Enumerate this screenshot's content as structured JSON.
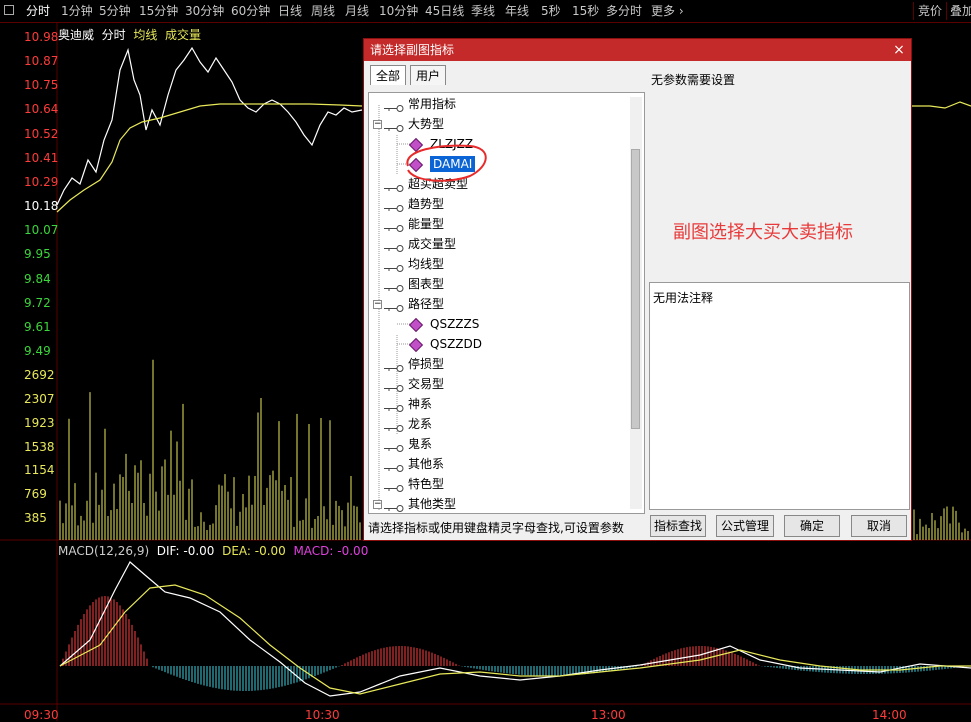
{
  "toolbar": {
    "items": [
      "分时",
      "1分钟",
      "5分钟",
      "15分钟",
      "30分钟",
      "60分钟",
      "日线",
      "周线",
      "月线",
      "10分钟",
      "45日线",
      "季线",
      "年线",
      "5秒",
      "15秒",
      "多分时",
      "更多"
    ],
    "right_items": [
      "竞价",
      "叠加"
    ]
  },
  "chart": {
    "legend": {
      "name": "奥迪威",
      "mode": "分时",
      "avg": "均线",
      "vol": "成交量"
    },
    "price_ticks": [
      "10.98",
      "10.87",
      "10.75",
      "10.64",
      "10.52",
      "10.41",
      "10.29",
      "10.18",
      "10.07",
      "9.95",
      "9.84",
      "9.72",
      "9.61",
      "9.49"
    ],
    "volume_ticks": [
      "2692",
      "2307",
      "1923",
      "1538",
      "1154",
      "769",
      "385"
    ],
    "macd_legend": {
      "title": "MACD(12,26,9)",
      "dif": "DIF: -0.00",
      "dea": "DEA: -0.00",
      "macd": "MACD: -0.00"
    },
    "time_labels": [
      "09:30",
      "10:30",
      "13:00",
      "14:00"
    ],
    "colors": {
      "up": "#ff3b3b",
      "down": "#3bd63b",
      "base": "#ffffff",
      "avg": "#e8e85a",
      "vol": "#e8e85a",
      "macd_pos": "#ff4040",
      "macd_neg": "#40d0e0",
      "dea": "#e8e85a",
      "dif": "#ffffff",
      "macd_text": "#e040e0"
    }
  },
  "dialog": {
    "title": "请选择副图指标",
    "close": "×",
    "tabs": [
      "全部",
      "用户"
    ],
    "tree": [
      {
        "label": "常用指标",
        "type": "group",
        "expanded": false
      },
      {
        "label": "大势型",
        "type": "group",
        "expanded": true
      },
      {
        "label": "ZLZJZZ",
        "type": "leaf"
      },
      {
        "label": "DAMAI",
        "type": "leaf",
        "selected": true
      },
      {
        "label": "超买超卖型",
        "type": "group",
        "expanded": false
      },
      {
        "label": "趋势型",
        "type": "group",
        "expanded": false
      },
      {
        "label": "能量型",
        "type": "group",
        "expanded": false
      },
      {
        "label": "成交量型",
        "type": "group",
        "expanded": false
      },
      {
        "label": "均线型",
        "type": "group",
        "expanded": false
      },
      {
        "label": "图表型",
        "type": "group",
        "expanded": false
      },
      {
        "label": "路径型",
        "type": "group",
        "expanded": true
      },
      {
        "label": "QSZZZS",
        "type": "leaf"
      },
      {
        "label": "QSZZDD",
        "type": "leaf"
      },
      {
        "label": "停损型",
        "type": "group",
        "expanded": false
      },
      {
        "label": "交易型",
        "type": "group",
        "expanded": false
      },
      {
        "label": "神系",
        "type": "group",
        "expanded": false
      },
      {
        "label": "龙系",
        "type": "group",
        "expanded": false
      },
      {
        "label": "鬼系",
        "type": "group",
        "expanded": false
      },
      {
        "label": "其他系",
        "type": "group",
        "expanded": false
      },
      {
        "label": "特色型",
        "type": "group",
        "expanded": false
      },
      {
        "label": "其他类型",
        "type": "group",
        "expanded": true
      }
    ],
    "param_text": "无参数需要设置",
    "note_text": "无用法注释",
    "hint": "请选择指标或使用键盘精灵字母查找,可设置参数",
    "buttons": [
      "指标查找",
      "公式管理",
      "确定",
      "取消"
    ]
  },
  "annotation": "副图选择大买大卖指标"
}
